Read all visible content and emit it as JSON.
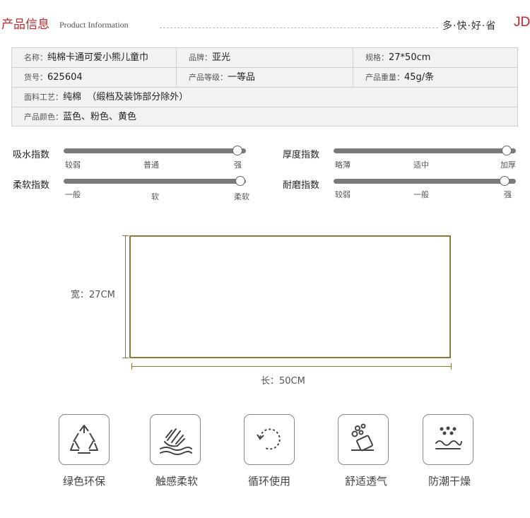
{
  "header": {
    "title": "产品信息",
    "subtitle": "Product Information",
    "tagline": "多·快·好·省",
    "brand": "JD",
    "accent_color": "#c0282d"
  },
  "info": {
    "name_label": "名称：",
    "name_value": "纯棉卡通可爱小熊儿童巾",
    "brand_label": "品牌：",
    "brand_value": "亚光",
    "spec_label": "规格：",
    "spec_value": "27*50cm",
    "sku_label": "货号：",
    "sku_value": "625604",
    "grade_label": "产品等级：",
    "grade_value": "一等品",
    "weight_label": "产品重量：",
    "weight_value": "45g/条",
    "material_label": "面料工艺：",
    "material_value": "纯棉  （缎档及装饰部分除外）",
    "color_label": "产品颜色：",
    "color_value": "蓝色、粉色、黄色"
  },
  "indices": [
    {
      "label": "吸水指数",
      "ticks": [
        "较弱",
        "普通",
        "强"
      ],
      "level": 1.0
    },
    {
      "label": "厚度指数",
      "ticks": [
        "略薄",
        "适中",
        "加厚"
      ],
      "level": 1.0
    },
    {
      "label": "柔软指数",
      "ticks": [
        "一般",
        "软",
        "柔软"
      ],
      "level": 1.0
    },
    {
      "label": "耐磨指数",
      "ticks": [
        "较弱",
        "一般",
        "强"
      ],
      "level": 1.0
    }
  ],
  "diagram": {
    "width_label": "宽：27CM",
    "length_label": "长：50CM"
  },
  "features": [
    {
      "label": "绿色环保",
      "icon": "recycle-icon"
    },
    {
      "label": "触感柔软",
      "icon": "hand-touch-icon"
    },
    {
      "label": "循环使用",
      "icon": "cycle-arrow-icon"
    },
    {
      "label": "舒适透气",
      "icon": "breathable-bubbles-icon"
    },
    {
      "label": "防潮干燥",
      "icon": "moisture-proof-icon"
    }
  ]
}
